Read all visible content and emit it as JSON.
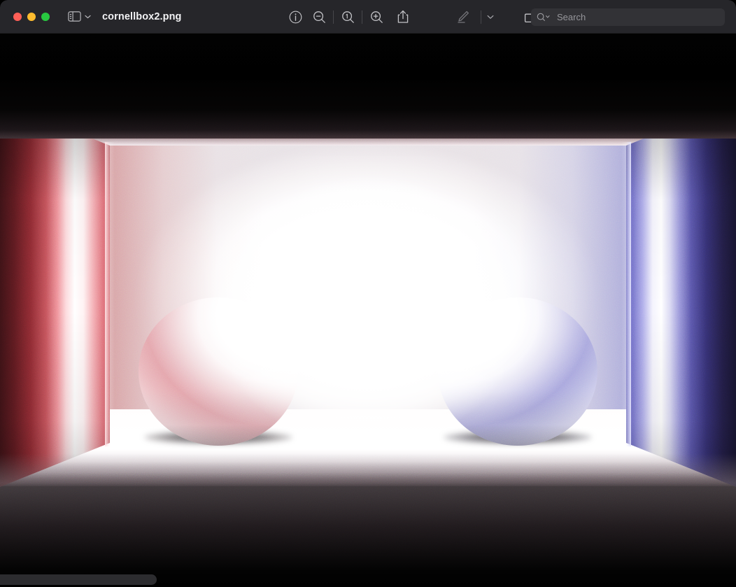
{
  "window": {
    "title": "cornellbox2.png",
    "traffic_lights": [
      {
        "name": "close",
        "color": "#ff5f57"
      },
      {
        "name": "minimize",
        "color": "#febc2e"
      },
      {
        "name": "zoom",
        "color": "#28c840"
      }
    ]
  },
  "toolbar": {
    "sidebar_toggle": {
      "icon": "sidebar-icon",
      "chevron": "chevron-down-icon"
    },
    "buttons": [
      {
        "name": "info-button",
        "icon": "info-circle-icon",
        "enabled": true
      },
      {
        "name": "zoom-out-button",
        "icon": "magnifier-minus-icon",
        "enabled": true
      },
      {
        "name": "zoom-actual-button",
        "icon": "magnifier-one-icon",
        "enabled": true
      },
      {
        "name": "zoom-in-button",
        "icon": "magnifier-plus-icon",
        "enabled": true
      },
      {
        "name": "share-button",
        "icon": "share-icon",
        "enabled": true
      },
      {
        "name": "markup-button",
        "icon": "pencil-icon",
        "enabled": false
      },
      {
        "name": "markup-menu-button",
        "icon": "chevron-down-icon",
        "enabled": true
      },
      {
        "name": "rotate-button",
        "icon": "rotate-icon",
        "enabled": true
      },
      {
        "name": "annotate-button",
        "icon": "annotate-circle-icon",
        "enabled": true
      }
    ]
  },
  "search": {
    "placeholder": "Search",
    "value": "",
    "icon": "search-magnifier-icon",
    "chevron": "chevron-down-icon"
  },
  "image": {
    "name": "cornellbox2.png",
    "description": "Path-traced Cornell box interior, over-exposed, with two diffuse spheres on the floor",
    "scene": {
      "left_wall_color": "#c5353f",
      "right_wall_color": "#3b35a8",
      "back_wall_color": "#ffffff",
      "floor_color": "#ffffff",
      "ceiling_light_color": "#ffffff",
      "sphere_color": "#f2eef0",
      "background_color": "#000000",
      "sphere_count": 2
    }
  },
  "scrollbars": {
    "horizontal": {
      "visible": true,
      "thumb_fraction": 0.213,
      "position": 0
    },
    "vertical": {
      "visible": false
    }
  }
}
